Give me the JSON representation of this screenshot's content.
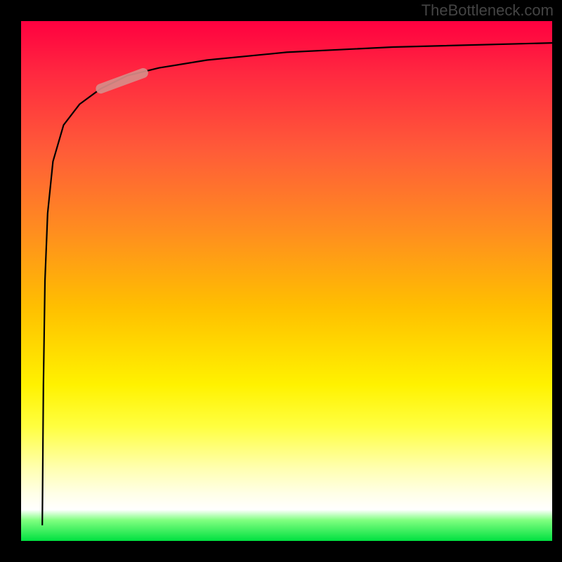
{
  "watermark": "TheBottleneck.com",
  "chart_data": {
    "type": "line",
    "title": "",
    "xlabel": "",
    "ylabel": "",
    "xlim": [
      0,
      100
    ],
    "ylim": [
      0,
      100
    ],
    "series": [
      {
        "name": "curve",
        "x": [
          4,
          4.2,
          4.5,
          5,
          6,
          8,
          11,
          15,
          20,
          26,
          35,
          50,
          70,
          100
        ],
        "y": [
          3,
          30,
          50,
          63,
          73,
          80,
          84,
          87,
          89.5,
          91,
          92.5,
          94,
          95,
          95.8
        ]
      }
    ],
    "highlight_segment": {
      "x_start": 15,
      "x_end": 23,
      "y_start": 87,
      "y_end": 90
    },
    "background_gradient": [
      {
        "pos": 0,
        "color": "#ff0040"
      },
      {
        "pos": 55,
        "color": "#ffbf00"
      },
      {
        "pos": 78,
        "color": "#ffff40"
      },
      {
        "pos": 94,
        "color": "#ffffff"
      },
      {
        "pos": 100,
        "color": "#00e040"
      }
    ]
  }
}
